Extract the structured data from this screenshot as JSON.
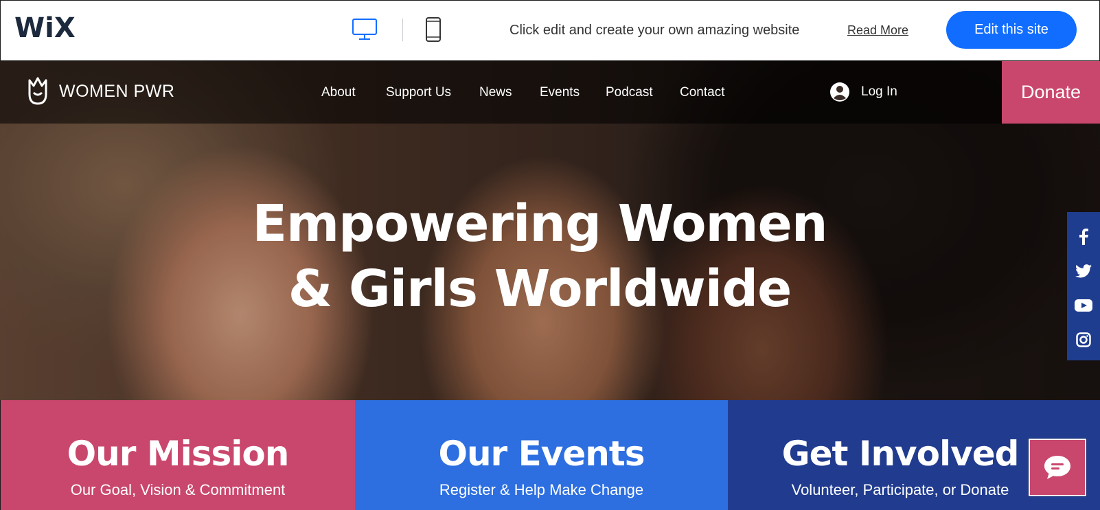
{
  "wix_bar": {
    "logo": "WiX",
    "message": "Click edit and create your own amazing website",
    "read_more": "Read More",
    "edit_button": "Edit this site",
    "accent_color": "#116dff",
    "devices": [
      "desktop-icon",
      "mobile-icon"
    ]
  },
  "site": {
    "brand": "WOMEN PWR",
    "nav": [
      "About",
      "Support Us",
      "News",
      "Events",
      "Podcast",
      "Contact"
    ],
    "login": "Log In",
    "donate": "Donate",
    "headline_line1": "Empowering Women",
    "headline_line2": "& Girls Worldwide",
    "social": [
      "facebook-icon",
      "twitter-icon",
      "youtube-icon",
      "instagram-icon"
    ],
    "colors": {
      "pink": "#c9476d",
      "blue": "#2d6fe0",
      "navy": "#213c8f"
    }
  },
  "cards": [
    {
      "title": "Our Mission",
      "subtitle": "Our Goal, Vision & Commitment"
    },
    {
      "title": "Our Events",
      "subtitle": "Register & Help Make Change"
    },
    {
      "title": "Get Involved",
      "subtitle": "Volunteer, Participate, or Donate"
    }
  ]
}
